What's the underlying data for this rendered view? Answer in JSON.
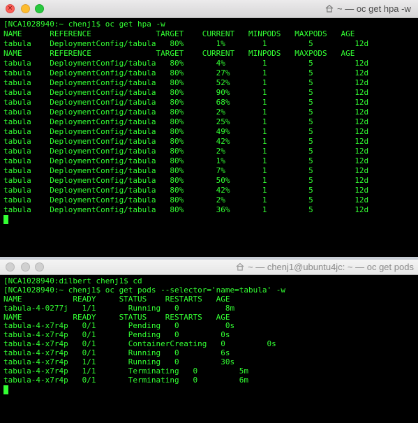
{
  "window1": {
    "title": "~ — oc get hpa -w",
    "lines": [
      "[NCA1028940:~ chenj1$ oc get hpa -w",
      "NAME      REFERENCE              TARGET    CURRENT   MINPODS   MAXPODS   AGE",
      "tabula    DeploymentConfig/tabula   80%       1%        1         5         12d",
      "NAME      REFERENCE              TARGET    CURRENT   MINPODS   MAXPODS   AGE",
      "tabula    DeploymentConfig/tabula   80%       4%        1         5         12d",
      "tabula    DeploymentConfig/tabula   80%       27%       1         5         12d",
      "tabula    DeploymentConfig/tabula   80%       52%       1         5         12d",
      "tabula    DeploymentConfig/tabula   80%       90%       1         5         12d",
      "tabula    DeploymentConfig/tabula   80%       68%       1         5         12d",
      "tabula    DeploymentConfig/tabula   80%       2%        1         5         12d",
      "tabula    DeploymentConfig/tabula   80%       25%       1         5         12d",
      "tabula    DeploymentConfig/tabula   80%       49%       1         5         12d",
      "tabula    DeploymentConfig/tabula   80%       42%       1         5         12d",
      "tabula    DeploymentConfig/tabula   80%       2%        1         5         12d",
      "tabula    DeploymentConfig/tabula   80%       1%        1         5         12d",
      "tabula    DeploymentConfig/tabula   80%       7%        1         5         12d",
      "tabula    DeploymentConfig/tabula   80%       50%       1         5         12d",
      "tabula    DeploymentConfig/tabula   80%       42%       1         5         12d",
      "tabula    DeploymentConfig/tabula   80%       2%        1         5         12d",
      "tabula    DeploymentConfig/tabula   80%       36%       1         5         12d"
    ]
  },
  "window2": {
    "title": "~ — chenj1@ubuntu4jc: ~ — oc get pods",
    "lines": [
      "[NCA1028940:dilbert chenj1$ cd",
      "[NCA1028940:~ chenj1$ oc get pods --selector='name=tabula' -w",
      "NAME           READY     STATUS    RESTARTS   AGE",
      "tabula-4-0277j   1/1       Running   0          8m",
      "NAME           READY     STATUS    RESTARTS   AGE",
      "tabula-4-x7r4p   0/1       Pending   0          0s",
      "tabula-4-x7r4p   0/1       Pending   0         0s",
      "tabula-4-x7r4p   0/1       ContainerCreating   0         0s",
      "tabula-4-x7r4p   0/1       Running   0         6s",
      "tabula-4-x7r4p   1/1       Running   0         30s",
      "tabula-4-x7r4p   1/1       Terminating   0         5m",
      "tabula-4-x7r4p   0/1       Terminating   0         6m"
    ]
  },
  "colors": {
    "terminal_text": "#33ff33",
    "terminal_bg": "#000000",
    "close_button": "#fc5f57",
    "minimize_button": "#fdbc2e",
    "maximize_button": "#28c840"
  },
  "icons": {
    "title_icon": "house-icon",
    "close": "close-icon",
    "minimize": "minimize-icon",
    "maximize": "maximize-icon"
  }
}
